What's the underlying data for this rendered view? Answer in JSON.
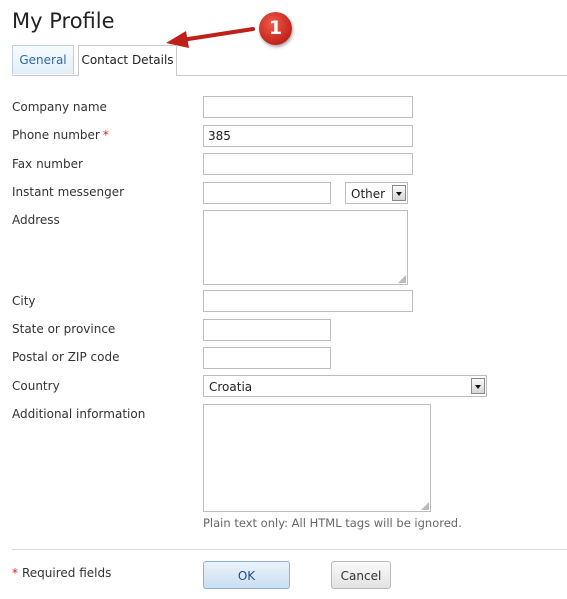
{
  "page": {
    "title": "My Profile",
    "callout_number": "1"
  },
  "tabs": [
    {
      "label": "General",
      "active": false
    },
    {
      "label": "Contact Details",
      "active": true
    }
  ],
  "form": {
    "company_name": {
      "label": "Company name",
      "value": ""
    },
    "phone_number": {
      "label": "Phone number",
      "value": "385",
      "required_mark": "*"
    },
    "fax_number": {
      "label": "Fax number",
      "value": ""
    },
    "instant_messenger": {
      "label": "Instant messenger",
      "value": "",
      "type_selected": "Other"
    },
    "address": {
      "label": "Address",
      "value": ""
    },
    "city": {
      "label": "City",
      "value": ""
    },
    "state_or_province": {
      "label": "State or province",
      "value": ""
    },
    "postal_code": {
      "label": "Postal or ZIP code",
      "value": ""
    },
    "country": {
      "label": "Country",
      "selected": "Croatia"
    },
    "additional_information": {
      "label": "Additional information",
      "value": "",
      "hint": "Plain text only: All HTML tags will be ignored."
    }
  },
  "footer": {
    "required_star": "*",
    "required_text": "Required fields",
    "ok_label": "OK",
    "cancel_label": "Cancel"
  },
  "colors": {
    "required": "#d0281e",
    "callout": "#c2231a",
    "arrow": "#c0201a",
    "tab_link": "#2a6aa8"
  }
}
